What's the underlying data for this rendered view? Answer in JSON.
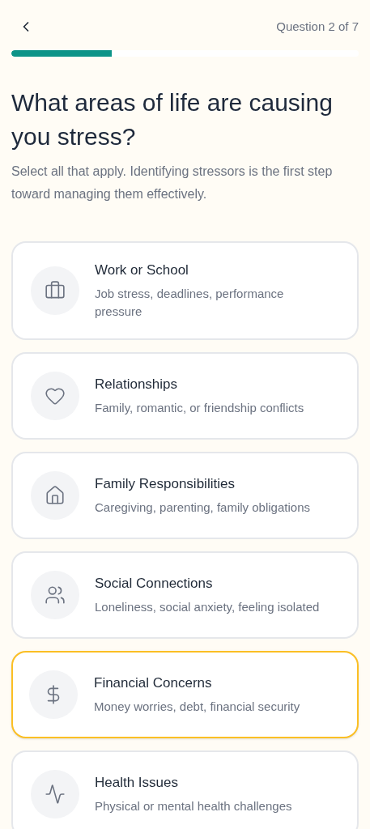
{
  "header": {
    "progress_text": "Question 2 of 7",
    "progress": {
      "level": 0.29
    }
  },
  "title": "What areas of life are causing you stress?",
  "subtitle": "Select all that apply. Identifying stressors is the first step toward managing them effectively.",
  "options": [
    {
      "title": "Work or School",
      "description": "Job stress, deadlines, performance pressure",
      "selected": false
    },
    {
      "title": "Relationships",
      "description": "Family, romantic, or friendship conflicts",
      "selected": false
    },
    {
      "title": "Family Responsibilities",
      "description": "Caregiving, parenting, family obligations",
      "selected": false
    },
    {
      "title": "Social Connections",
      "description": "Loneliness, social anxiety, feeling isolated",
      "selected": false
    },
    {
      "title": "Financial Concerns",
      "description": "Money worries, debt, financial security",
      "selected": true
    },
    {
      "title": "Health Issues",
      "description": "Physical or mental health challenges",
      "selected": false
    }
  ]
}
